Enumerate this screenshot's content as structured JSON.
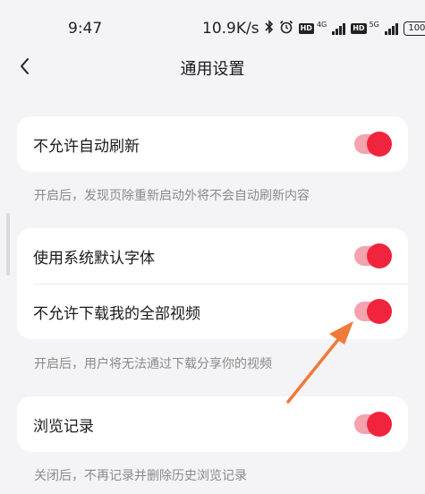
{
  "status_bar": {
    "time": "9:47",
    "speed": "10.9K/s",
    "net_left": "4G",
    "net_right": "5G",
    "hd": "HD",
    "battery": "100",
    "icons": [
      "bluetooth-icon",
      "alarm-icon",
      "signal-icon"
    ]
  },
  "header": {
    "back_icon": "chevron-left-icon",
    "title": "通用设置"
  },
  "settings": [
    {
      "label": "不允许自动刷新",
      "enabled": true,
      "hint": "开启后，发现页除重新启动外将不会自动刷新内容"
    },
    {
      "label": "使用系统默认字体",
      "enabled": true
    },
    {
      "label": "不允许下载我的全部视频",
      "enabled": true,
      "hint": "开启后，用户将无法通过下载分享你的视频"
    },
    {
      "label": "浏览记录",
      "enabled": true,
      "hint": "关闭后，不再记录并删除历史浏览记录"
    }
  ],
  "colors": {
    "accent": "#f0253d",
    "track": "#f5a3af",
    "annotation_arrow": "#f07a3a",
    "background": "#f4f4f6"
  }
}
